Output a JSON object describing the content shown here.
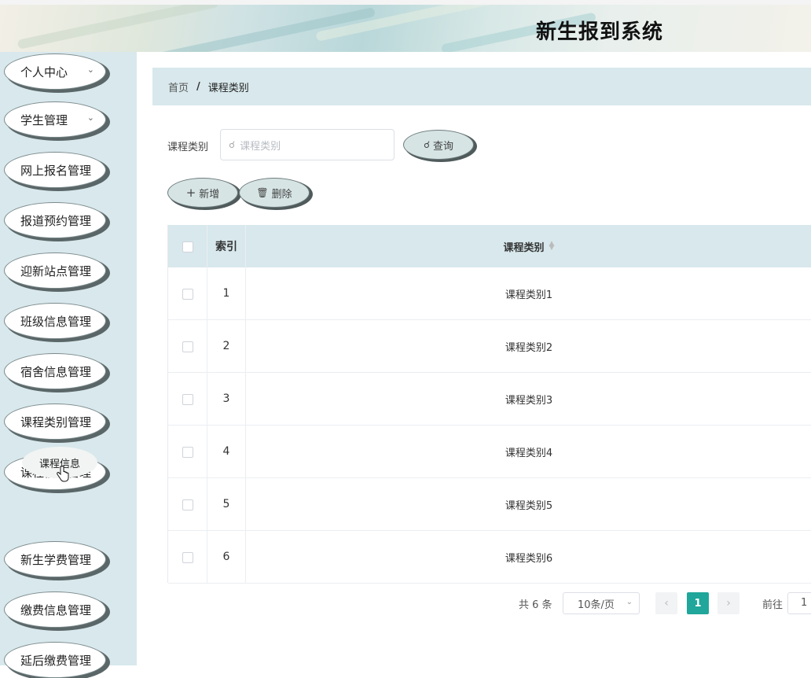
{
  "header": {
    "title": "新生报到系统"
  },
  "sidebar": {
    "items": [
      {
        "label": "个人中心",
        "chevron": true
      },
      {
        "label": "学生管理",
        "chevron": true
      },
      {
        "label": "网上报名管理",
        "chevron": false
      },
      {
        "label": "报道预约管理",
        "chevron": false
      },
      {
        "label": "迎新站点管理",
        "chevron": false
      },
      {
        "label": "班级信息管理",
        "chevron": false
      },
      {
        "label": "宿舍信息管理",
        "chevron": false
      },
      {
        "label": "课程类别管理",
        "chevron": false
      },
      {
        "label": "课程信息管理",
        "chevron": false
      },
      {
        "label": "新生学费管理",
        "chevron": false
      },
      {
        "label": "缴费信息管理",
        "chevron": false
      },
      {
        "label": "延后缴费管理",
        "chevron": false
      }
    ],
    "sub_item": "课程信息"
  },
  "breadcrumb": {
    "home": "首页",
    "separator": "/",
    "current": "课程类别"
  },
  "search": {
    "label": "课程类别",
    "placeholder": "课程类别",
    "button": "查询"
  },
  "actions": {
    "add": "新增",
    "delete": "删除"
  },
  "table": {
    "columns": {
      "index": "索引",
      "category": "课程类别"
    },
    "rows": [
      {
        "index": "1",
        "category": "课程类别1"
      },
      {
        "index": "2",
        "category": "课程类别2"
      },
      {
        "index": "3",
        "category": "课程类别3"
      },
      {
        "index": "4",
        "category": "课程类别4"
      },
      {
        "index": "5",
        "category": "课程类别5"
      },
      {
        "index": "6",
        "category": "课程类别6"
      }
    ]
  },
  "pagination": {
    "total": "共 6 条",
    "page_size": "10条/页",
    "current_page": "1",
    "goto_label": "前往",
    "goto_value": "1"
  },
  "colors": {
    "accent": "#20a69a",
    "panel": "#d8e8ec"
  }
}
